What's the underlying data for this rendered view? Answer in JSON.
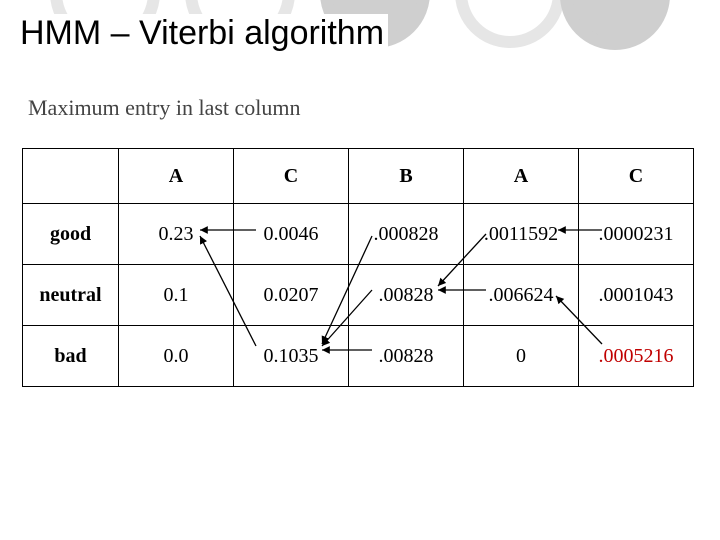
{
  "title": "HMM – Viterbi algorithm",
  "subtitle": "Maximum entry in last column",
  "columns": [
    "A",
    "C",
    "B",
    "A",
    "C"
  ],
  "row_labels": [
    "good",
    "neutral",
    "bad"
  ],
  "cells": {
    "good": [
      "0.23",
      "0.0046",
      ".000828",
      ".0011592",
      ".0000231"
    ],
    "neutral": [
      "0.1",
      "0.0207",
      ".00828",
      ".006624",
      ".0001043"
    ],
    "bad": [
      "0.0",
      "0.1035",
      ".00828",
      "0",
      ".0005216"
    ]
  },
  "highlight": {
    "row": "bad",
    "col_index": 4
  },
  "chart_data": {
    "type": "table",
    "title": "HMM – Viterbi algorithm",
    "subtitle": "Maximum entry in last column",
    "columns": [
      "A",
      "C",
      "B",
      "A",
      "C"
    ],
    "rows": [
      "good",
      "neutral",
      "bad"
    ],
    "values": [
      [
        0.23,
        0.0046,
        0.000828,
        0.0011592,
        2.31e-05
      ],
      [
        0.1,
        0.0207,
        0.00828,
        0.006624,
        0.0001043
      ],
      [
        0.0,
        0.1035,
        0.00828,
        0,
        0.0005216
      ]
    ],
    "backpointers": [
      {
        "from_col": 1,
        "from_row": "good",
        "to_col": 0,
        "to_row": "good"
      },
      {
        "from_col": 1,
        "from_row": "bad",
        "to_col": 0,
        "to_row": "good"
      },
      {
        "from_col": 2,
        "from_row": "good",
        "to_col": 1,
        "to_row": "bad"
      },
      {
        "from_col": 2,
        "from_row": "neutral",
        "to_col": 1,
        "to_row": "bad"
      },
      {
        "from_col": 2,
        "from_row": "bad",
        "to_col": 1,
        "to_row": "bad"
      },
      {
        "from_col": 3,
        "from_row": "good",
        "to_col": 2,
        "to_row": "neutral"
      },
      {
        "from_col": 3,
        "from_row": "neutral",
        "to_col": 2,
        "to_row": "neutral"
      },
      {
        "from_col": 4,
        "from_row": "good",
        "to_col": 3,
        "to_row": "good"
      },
      {
        "from_col": 4,
        "from_row": "bad",
        "to_col": 3,
        "to_row": "neutral"
      }
    ],
    "max_last_column": {
      "row": "bad",
      "value": 0.0005216
    }
  }
}
